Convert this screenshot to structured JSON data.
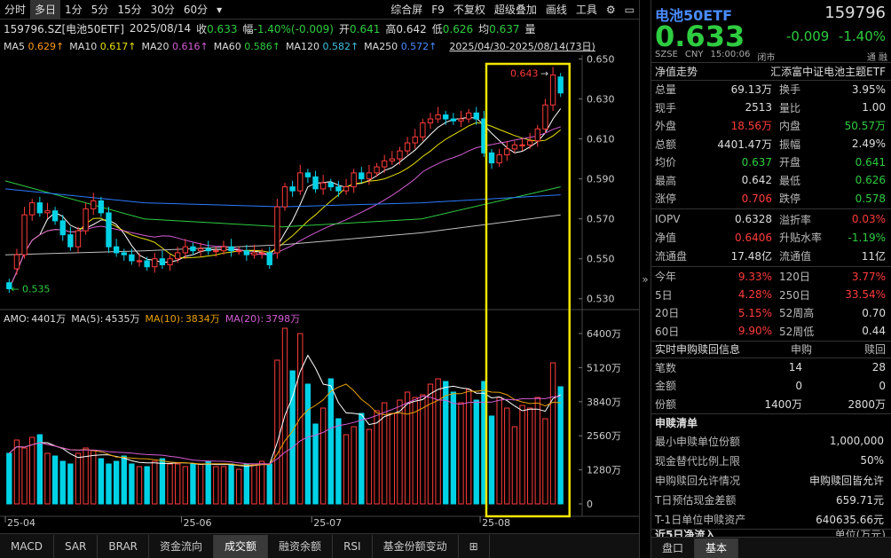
{
  "toolbar": {
    "left": [
      "分时",
      "多日",
      "1分",
      "5分",
      "15分",
      "30分",
      "60分"
    ],
    "more": "▾",
    "right": [
      "综合屏",
      "F9",
      "不复权",
      "超级叠加",
      "画线",
      "工具"
    ]
  },
  "info": {
    "code": "159796.SZ[电池50ETF]",
    "date": "2025/08/14",
    "close_l": "收",
    "close": "0.633",
    "chg_l": "幅",
    "chg": "-1.40%(-0.009)",
    "open_l": "开",
    "open": "0.641",
    "high_l": "高",
    "high": "0.642",
    "low_l": "低",
    "low": "0.626",
    "avg_l": "均",
    "avg": "0.637",
    "vol_l": "量"
  },
  "ma": {
    "ma5_l": "MA5",
    "ma5": "0.629↑",
    "ma10_l": "MA10",
    "ma10": "0.617↑",
    "ma20_l": "MA20",
    "ma20": "0.616↑",
    "ma60_l": "MA60",
    "ma60": "0.586↑",
    "ma120_l": "MA120",
    "ma120": "0.582↑",
    "ma250_l": "MA250",
    "ma250": "0.572↑",
    "range": "2025/04/30-2025/08/14(73日)"
  },
  "price_axis": [
    "0.650",
    "0.630",
    "0.610",
    "0.590",
    "0.570",
    "0.550",
    "0.530"
  ],
  "annot": {
    "high_label": "0.643",
    "high_arrow": "→",
    "low_label": "← 0.535"
  },
  "amo": {
    "amo_l": "AMO:",
    "amo": "4401万",
    "ma5_l": "MA(5):",
    "ma5": "4535万",
    "ma10_l": "MA(10):",
    "ma10": "3834万",
    "ma20_l": "MA(20):",
    "ma20": "3798万"
  },
  "vol_axis": [
    "6400万",
    "5120万",
    "3840万",
    "2560万",
    "1280万",
    "0"
  ],
  "dates": [
    "25-04",
    "25-06",
    "25-07",
    "25-08"
  ],
  "tabs": [
    "MACD",
    "SAR",
    "BRAR",
    "资金流向",
    "成交额",
    "融资余额",
    "RSI",
    "基金份额变动",
    "⊞"
  ],
  "collapse": "»",
  "rp": {
    "title": "电池50ETF",
    "code": "159796",
    "price": "0.633",
    "chg": "-0.009",
    "pct": "-1.40%",
    "sub": [
      "SZSE",
      "CNY",
      "15:00:06",
      "闭市"
    ],
    "sub_r": "通 融",
    "nav_l": "净值走势",
    "nav_name": "汇添富中证电池主题ETF",
    "rows": [
      [
        "总量",
        "69.13万",
        "换手",
        "3.95%"
      ],
      [
        "现手",
        "2513",
        "量比",
        "1.00"
      ],
      [
        "外盘",
        "18.56万",
        "内盘",
        "50.57万"
      ],
      [
        "总额",
        "4401.47万",
        "振幅",
        "2.49%"
      ],
      [
        "均价",
        "0.637",
        "开盘",
        "0.641"
      ],
      [
        "最高",
        "0.642",
        "最低",
        "0.626"
      ],
      [
        "涨停",
        "0.706",
        "跌停",
        "0.578"
      ],
      [
        "IOPV",
        "0.6328",
        "溢折率",
        "0.03%"
      ],
      [
        "净值",
        "0.6406",
        "升贴水率",
        "-1.19%"
      ],
      [
        "流通盘",
        "17.48亿",
        "流通值",
        "11亿"
      ],
      [
        "今年",
        "9.33%",
        "120日",
        "3.77%"
      ],
      [
        "5日",
        "4.28%",
        "250日",
        "33.54%"
      ],
      [
        "20日",
        "5.15%",
        "52周高",
        "0.70"
      ],
      [
        "60日",
        "9.90%",
        "52周低",
        "0.44"
      ]
    ],
    "sg_title": "实时申购赎回信息",
    "sg_h1": "申购",
    "sg_h2": "赎回",
    "sg": [
      [
        "笔数",
        "14",
        "28"
      ],
      [
        "金额",
        "0",
        "0"
      ],
      [
        "份额",
        "1400万",
        "2800万"
      ]
    ],
    "qd_title": "申赎清单",
    "qd": [
      [
        "最小申赎单位份额",
        "1,000,000"
      ],
      [
        "现金替代比例上限",
        "50%"
      ],
      [
        "申购赎回允许情况",
        "申购赎回皆允许"
      ],
      [
        "T日预估现金差额",
        "659.71元"
      ],
      [
        "T-1日单位申赎资产",
        "640635.66元"
      ]
    ],
    "cut": "近5日净流入",
    "cut_r": "单位(万元)",
    "btabs": [
      "盘口",
      "基本"
    ]
  },
  "colors": {
    "up": "#ff3b3b",
    "down": "#00d2e6",
    "ma5": "#ffffff",
    "ma10": "#e8e200",
    "ma20": "#d45cd4",
    "ma60": "#2ecc40",
    "ma120": "#2b7bff",
    "ma250": "#c0c0c0",
    "box": "#f5e600"
  },
  "chart_data": {
    "type": "candlestick",
    "x": [
      "25-04-30",
      "25-05-06",
      "25-05-07",
      "25-05-08",
      "25-05-09",
      "25-05-12",
      "25-05-13",
      "25-05-14",
      "25-05-15",
      "25-05-16",
      "25-05-19",
      "25-05-20",
      "25-05-21",
      "25-05-22",
      "25-05-23",
      "25-05-26",
      "25-05-27",
      "25-05-28",
      "25-05-29",
      "25-05-30",
      "25-06-03",
      "25-06-04",
      "25-06-05",
      "25-06-06",
      "25-06-09",
      "25-06-10",
      "25-06-11",
      "25-06-12",
      "25-06-13",
      "25-06-16",
      "25-06-17",
      "25-06-18",
      "25-06-19",
      "25-06-20",
      "25-06-23",
      "25-06-24",
      "25-06-25",
      "25-06-26",
      "25-06-27",
      "25-06-30",
      "25-07-01",
      "25-07-02",
      "25-07-03",
      "25-07-04",
      "25-07-07",
      "25-07-08",
      "25-07-09",
      "25-07-10",
      "25-07-11",
      "25-07-14",
      "25-07-15",
      "25-07-16",
      "25-07-17",
      "25-07-18",
      "25-07-21",
      "25-07-22",
      "25-07-23",
      "25-07-24",
      "25-07-25",
      "25-07-28",
      "25-07-29",
      "25-07-30",
      "25-07-31",
      "25-08-01",
      "25-08-04",
      "25-08-05",
      "25-08-06",
      "25-08-07",
      "25-08-08",
      "25-08-11",
      "25-08-12",
      "25-08-13",
      "25-08-14"
    ],
    "open": [
      0.538,
      0.545,
      0.552,
      0.572,
      0.578,
      0.573,
      0.574,
      0.569,
      0.562,
      0.556,
      0.564,
      0.575,
      0.579,
      0.573,
      0.556,
      0.553,
      0.552,
      0.549,
      0.549,
      0.546,
      0.55,
      0.547,
      0.55,
      0.553,
      0.556,
      0.554,
      0.555,
      0.554,
      0.554,
      0.556,
      0.554,
      0.554,
      0.552,
      0.553,
      0.553,
      0.553,
      0.576,
      0.586,
      0.584,
      0.593,
      0.591,
      0.585,
      0.588,
      0.586,
      0.584,
      0.586,
      0.593,
      0.59,
      0.593,
      0.596,
      0.599,
      0.6,
      0.604,
      0.608,
      0.611,
      0.618,
      0.62,
      0.622,
      0.62,
      0.619,
      0.62,
      0.623,
      0.62,
      0.603,
      0.598,
      0.602,
      0.605,
      0.607,
      0.607,
      0.609,
      0.615,
      0.627,
      0.641
    ],
    "close": [
      0.535,
      0.552,
      0.572,
      0.578,
      0.573,
      0.574,
      0.569,
      0.562,
      0.556,
      0.564,
      0.575,
      0.579,
      0.573,
      0.556,
      0.553,
      0.552,
      0.549,
      0.549,
      0.546,
      0.55,
      0.547,
      0.55,
      0.553,
      0.556,
      0.554,
      0.555,
      0.554,
      0.554,
      0.556,
      0.554,
      0.554,
      0.552,
      0.553,
      0.553,
      0.547,
      0.576,
      0.586,
      0.584,
      0.593,
      0.591,
      0.585,
      0.588,
      0.586,
      0.584,
      0.586,
      0.593,
      0.59,
      0.593,
      0.596,
      0.599,
      0.6,
      0.604,
      0.608,
      0.611,
      0.618,
      0.62,
      0.622,
      0.62,
      0.619,
      0.62,
      0.623,
      0.62,
      0.603,
      0.598,
      0.602,
      0.605,
      0.607,
      0.607,
      0.609,
      0.615,
      0.627,
      0.642,
      0.633
    ],
    "amount_wan": [
      1900,
      2400,
      2100,
      2500,
      2600,
      1900,
      1800,
      1600,
      1500,
      1900,
      2100,
      2000,
      1700,
      1500,
      1600,
      1800,
      1500,
      1400,
      1400,
      1600,
      1700,
      1500,
      1500,
      1400,
      1500,
      1500,
      1600,
      1400,
      1400,
      1500,
      1300,
      1500,
      1500,
      1600,
      1500,
      5400,
      6600,
      5000,
      6400,
      4500,
      3000,
      3600,
      4700,
      3200,
      2600,
      2900,
      3400,
      2800,
      3500,
      3800,
      3400,
      3900,
      4200,
      4000,
      4100,
      4500,
      4700,
      4600,
      4200,
      3800,
      4300,
      3900,
      4600,
      3300,
      4000,
      3600,
      2900,
      3700,
      3600,
      4000,
      3200,
      5300,
      4401
    ],
    "ylim": [
      0.525,
      0.652
    ],
    "vol_ylim": [
      0,
      6600
    ],
    "highlight": [
      63,
      72
    ]
  }
}
